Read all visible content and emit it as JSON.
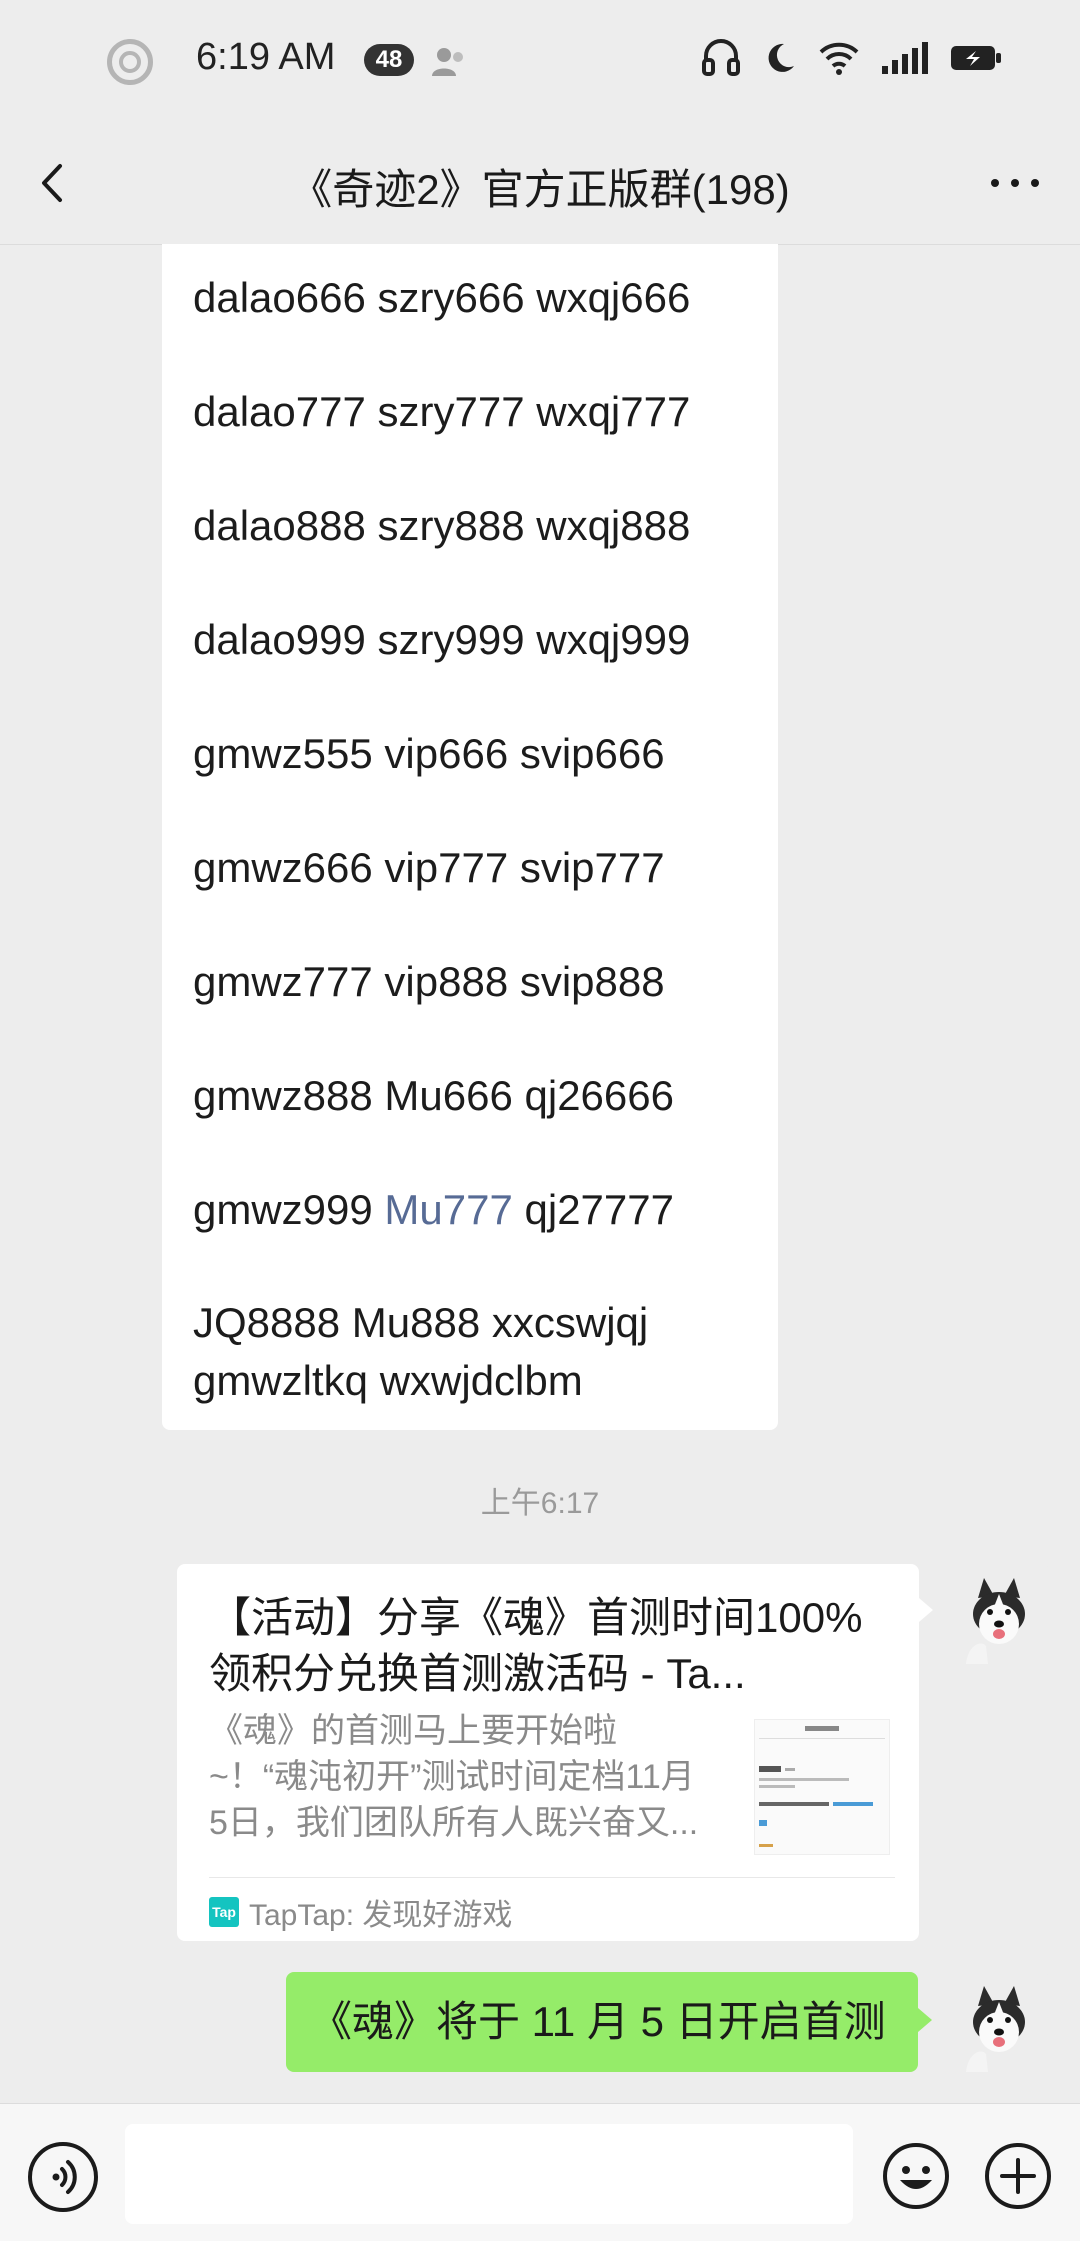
{
  "status_bar": {
    "time": "6:19 AM",
    "notification_count": "48"
  },
  "nav": {
    "title": "《奇迹2》官方正版群(198)"
  },
  "code_message": {
    "lines": [
      "dalao666 szry666 wxqj666",
      "dalao777 szry777 wxqj777",
      "dalao888 szry888 wxqj888",
      "dalao999 szry999 wxqj999",
      "gmwz555 vip666 svip666",
      "gmwz666 vip777 svip777",
      "gmwz777 vip888 svip888",
      "gmwz888 Mu666 qj26666"
    ],
    "line9_before": "gmwz999 ",
    "line9_link": "Mu777",
    "line9_after": " qj27777",
    "line10": "JQ8888 Mu888 xxcswjqj gmwzltkq  wxwjdclbm"
  },
  "timestamp": "上午6:17",
  "link_card": {
    "title": "【活动】分享《魂》首测时间100%领积分兑换首测激活码 - Ta...",
    "description": "《魂》的首测马上要开始啦~！“魂沌初开”测试时间定档11月5日，我们团队所有人既兴奋又...",
    "source": "TapTap: 发现好游戏",
    "source_logo_text": "Tap"
  },
  "sent_message": {
    "text": "《魂》将于 11 月 5 日开启首测"
  },
  "input": {
    "value": ""
  },
  "colors": {
    "background": "#ededed",
    "sent_bubble": "#95ec69",
    "link": "#576b95"
  }
}
